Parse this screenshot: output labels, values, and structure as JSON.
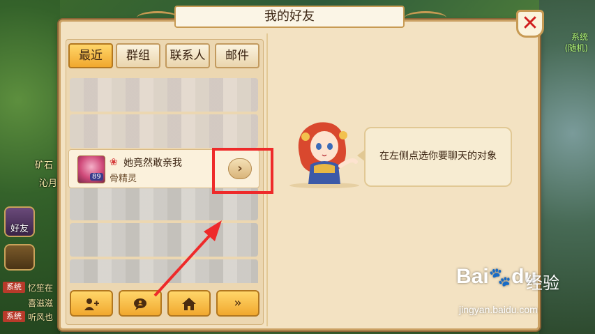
{
  "window": {
    "title": "我的好友"
  },
  "tabs": [
    {
      "label": "最近",
      "active": true
    },
    {
      "label": "群组",
      "active": false
    },
    {
      "label": "联系人",
      "active": false
    },
    {
      "label": "邮件",
      "active": false
    }
  ],
  "friend": {
    "name": "她竟然敢亲我",
    "status": "骨精灵",
    "level": "89"
  },
  "chat_prompt": "在左侧点选你要聊天的对象",
  "bottom_buttons": [
    {
      "icon": "add-friend-icon"
    },
    {
      "icon": "chat-bubble-icon"
    },
    {
      "icon": "home-icon"
    },
    {
      "label": "»",
      "icon": "forward-icon"
    }
  ],
  "left_hud": {
    "location_text": "矿石",
    "location_text2": "沁月",
    "friends_label": "好友",
    "system_tag": "系统",
    "system_messages": [
      "忆笙在",
      "喜滋滋",
      "听风也"
    ]
  },
  "right_hud": {
    "text1": "系统",
    "text2": "(随机)"
  },
  "watermark": {
    "logo": "Bai",
    "logo_suffix": "du",
    "cn": "经验",
    "url": "jingyan.baidu.com"
  },
  "colors": {
    "highlight": "#ee2a2a",
    "tab_active": "#f1a82e",
    "panel": "#f3e2c2"
  }
}
